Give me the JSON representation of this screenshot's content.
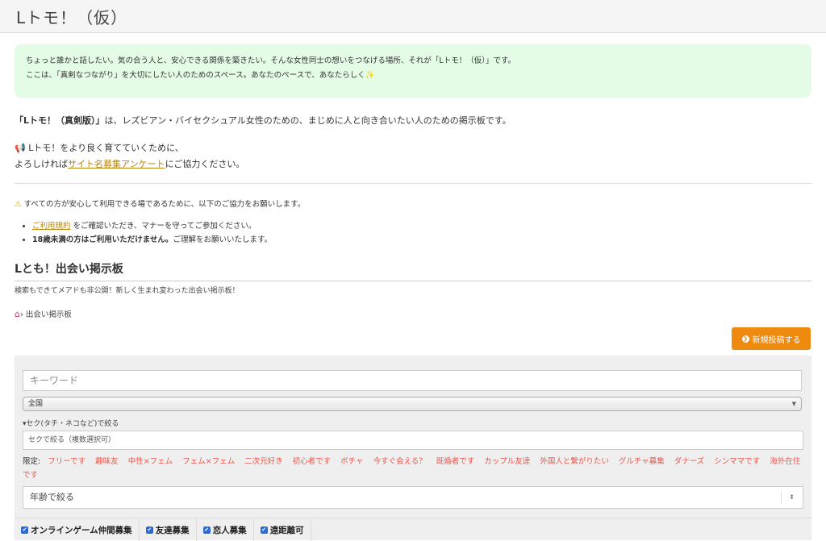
{
  "site": {
    "title": "Lトモ！（仮）"
  },
  "notice": {
    "line1": "ちょっと誰かと話したい。気の合う人と、安心できる関係を築きたい。そんな女性同士の想いをつなげる場所、それが「Lトモ！（仮）」です。",
    "line2": "ここは、「真剣なつながり」を大切にしたい人のためのスペース。あなたのペースで、あなたらしく",
    "sparkle": "✨"
  },
  "intro": {
    "bold": "「Lトモ！（真剣版）」",
    "text": "は、レズビアン・バイセクシュアル女性のための、まじめに人と向き合いたい人のための掲示板です。"
  },
  "cta": {
    "megaphone": "📢",
    "line1": "Lトモ！をより良く育てていくために、",
    "pre": "よろしければ",
    "link": "サイト名募集アンケート",
    "post": "にご協力ください。"
  },
  "warning": {
    "icon": "⚠",
    "text": "すべての方が安心して利用できる場であるために、以下のご協力をお願いします。"
  },
  "rules": {
    "r1_link": "ご利用規約",
    "r1_text": "をご確認いただき、マナーを守ってご参加ください。",
    "r2_bold": "18歳未満の方はご利用いただけません。",
    "r2_text": "ご理解をお願いいたします。"
  },
  "board": {
    "title": "Lとも！出会い掲示板",
    "subtitle": "検索もできてメアドも非公開！新しく生まれ変わった出会い掲示板！"
  },
  "breadcrumb": {
    "separator": "›",
    "current": "出会い掲示板"
  },
  "new_post": {
    "label": "新規投稿する"
  },
  "search": {
    "keyword_placeholder": "キーワード",
    "region": "全国",
    "seku_toggle": "セク(タチ・ネコなど)で絞る",
    "seku_placeholder": "セクで絞る（複数選択可）",
    "limit_label": "限定:",
    "limits": [
      "フリーです",
      "趣味友",
      "中性×フェム",
      "フェム×フェム",
      "二次元好き",
      "初心者です",
      "ボチャ",
      "今すぐ会える？",
      "既婚者です",
      "カップル友達",
      "外国人と繋がりたい",
      "グルチャ募集",
      "ダナーズ",
      "シンママです",
      "海外在住です"
    ],
    "age": "年齢で絞る",
    "checks": [
      "オンラインゲーム仲間募集",
      "友達募集",
      "恋人募集",
      "遠距離可"
    ]
  },
  "colors": {
    "accent": "#ee8a0e",
    "link": "#b8860b",
    "tag": "#e8574d",
    "notice_bg": "#e4fbe6"
  }
}
